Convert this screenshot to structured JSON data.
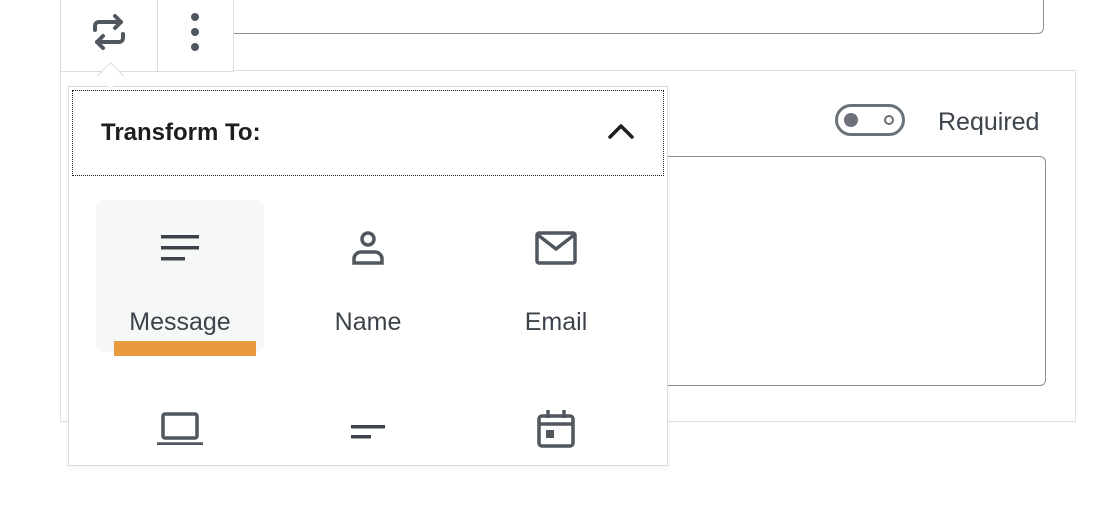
{
  "toolbar": {
    "transform_icon": "transform-arrows-icon",
    "more_icon": "vertical-ellipsis-icon"
  },
  "field": {
    "required_label": "Required",
    "toggle_state": "off"
  },
  "popover": {
    "title": "Transform To:",
    "collapse_icon": "chevron-up-icon",
    "items": [
      {
        "label": "Message",
        "icon": "text-lines-icon",
        "active": true
      },
      {
        "label": "Name",
        "icon": "person-icon"
      },
      {
        "label": "Email",
        "icon": "envelope-icon"
      },
      {
        "label": "",
        "icon": "laptop-icon"
      },
      {
        "label": "",
        "icon": "short-lines-icon"
      },
      {
        "label": "",
        "icon": "calendar-icon"
      }
    ]
  },
  "colors": {
    "accent_highlight": "#ea9a3e",
    "icon_gray": "#50575e",
    "text": "#1e1e1e"
  }
}
